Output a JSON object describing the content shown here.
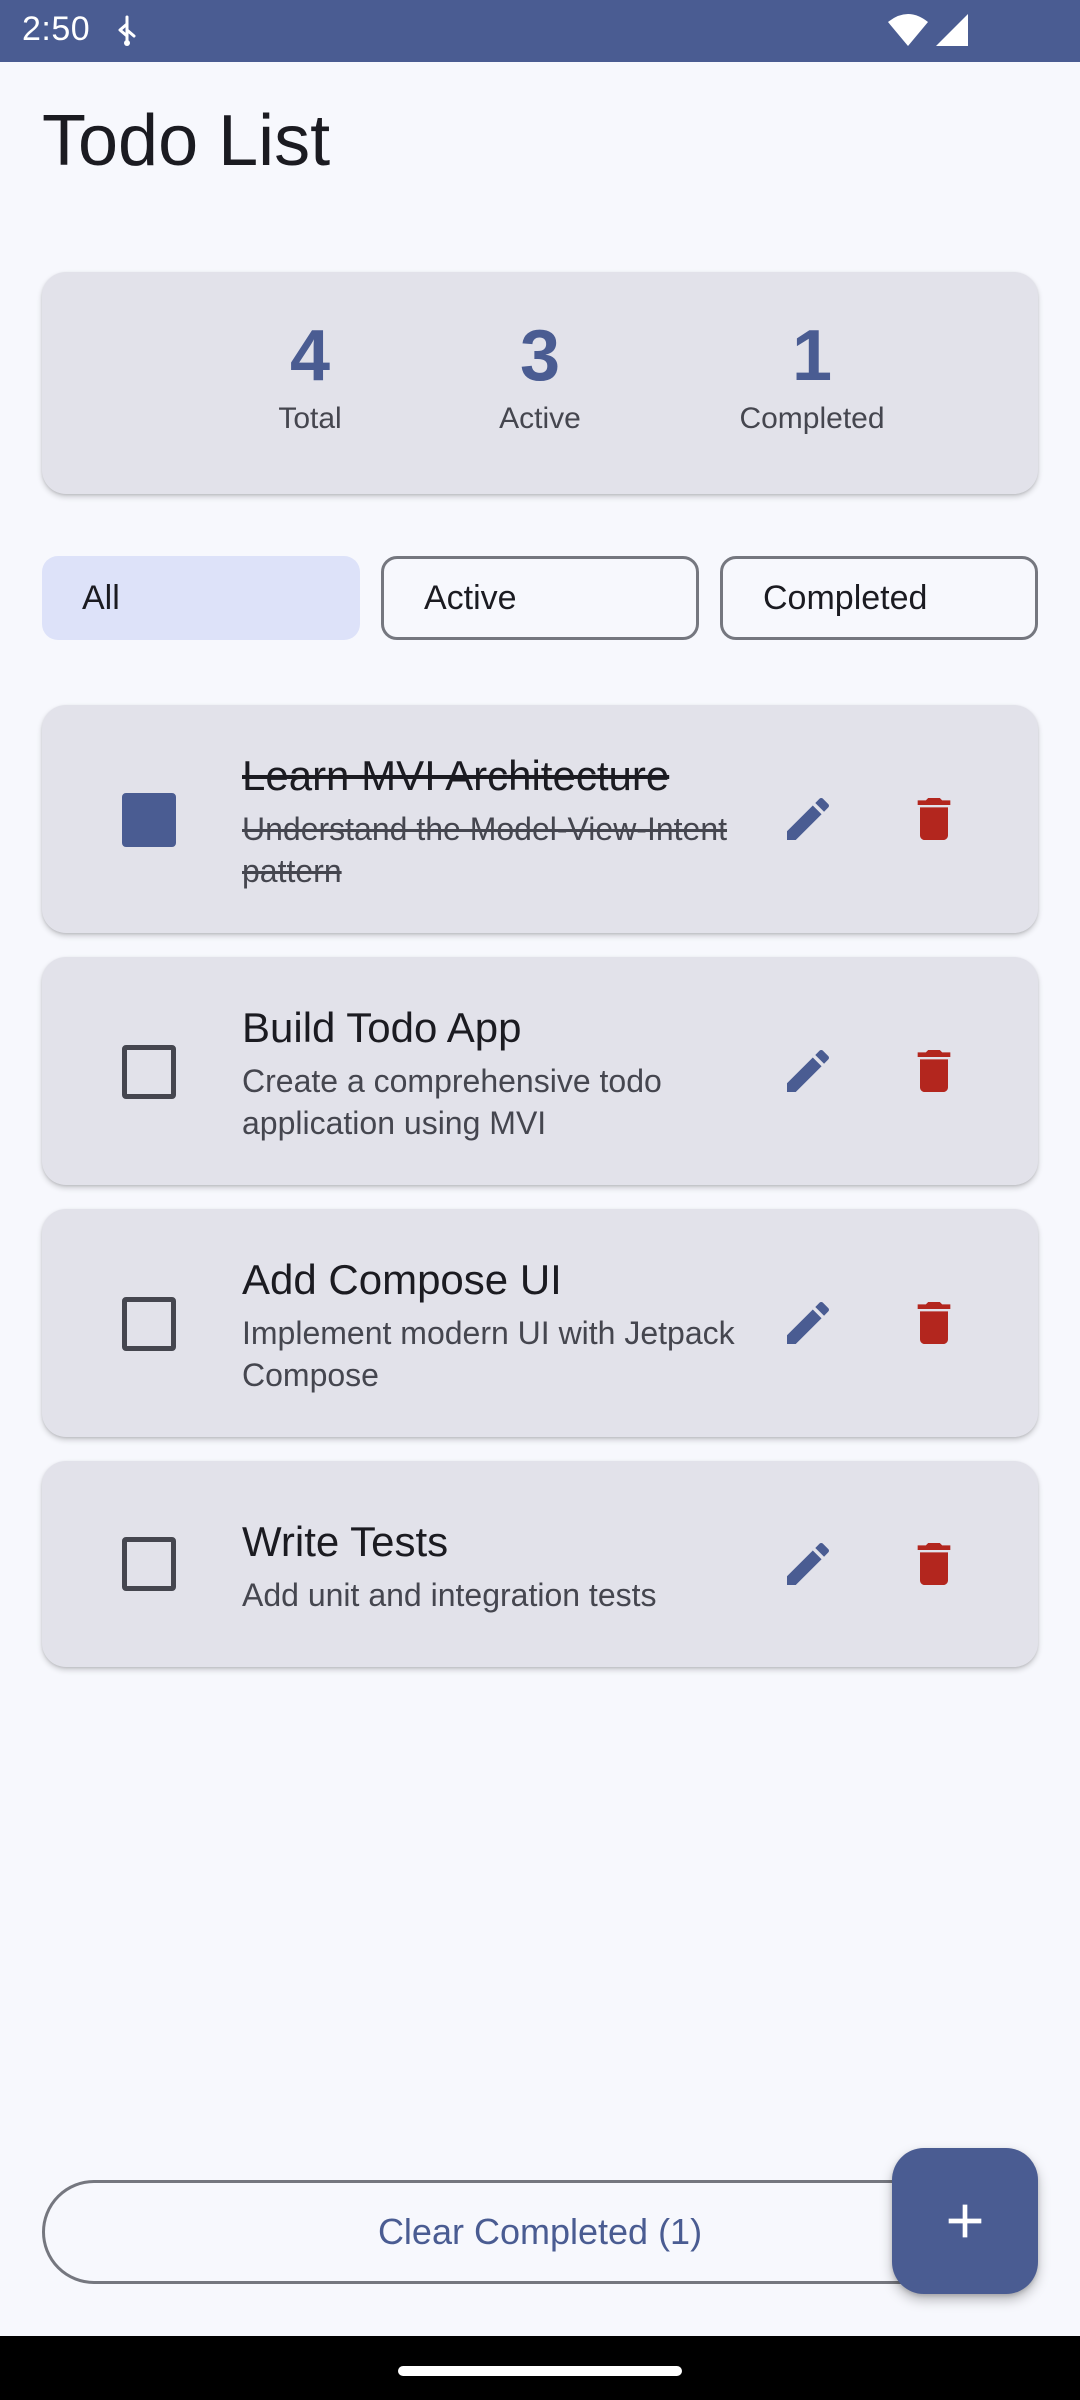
{
  "status_bar": {
    "time": "2:50",
    "background": "#4a5c92"
  },
  "title": "Todo List",
  "stats": {
    "total": {
      "value": "4",
      "label": "Total"
    },
    "active": {
      "value": "3",
      "label": "Active"
    },
    "completed": {
      "value": "1",
      "label": "Completed"
    }
  },
  "filters": [
    {
      "label": "All",
      "selected": true
    },
    {
      "label": "Active",
      "selected": false
    },
    {
      "label": "Completed",
      "selected": false
    }
  ],
  "todos": [
    {
      "title": "Learn MVI Architecture",
      "description": "Understand the Model-View-Intent pattern",
      "completed": true
    },
    {
      "title": "Build Todo App",
      "description": "Create a comprehensive todo application using MVI",
      "completed": false
    },
    {
      "title": "Add Compose UI",
      "description": "Implement modern UI with Jetpack Compose",
      "completed": false
    },
    {
      "title": "Write Tests",
      "description": "Add unit and integration tests",
      "completed": false
    }
  ],
  "clear_button": "Clear Completed (1)",
  "icons": {
    "edit": "edit-pencil-icon",
    "delete": "trash-icon",
    "add": "plus-icon"
  },
  "colors": {
    "primary": "#4a5c92",
    "error": "#b3261e",
    "card": "#e2e2ea",
    "background": "#f7f8fd",
    "chip_selected": "#dde2f9"
  }
}
